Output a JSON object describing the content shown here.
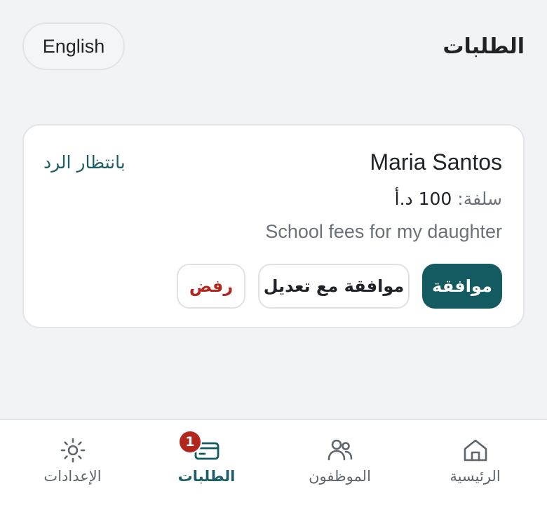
{
  "header": {
    "title": "الطلبات",
    "language_button": "English"
  },
  "request": {
    "employee_name": "Maria Santos",
    "status": "بانتظار الرد",
    "type_label": "سلفة:",
    "amount": "100 د.أ",
    "reason": "School fees for my daughter",
    "actions": {
      "approve": "موافقة",
      "approve_with_edit": "موافقة مع تعديل",
      "reject": "رفض"
    }
  },
  "nav": {
    "home": {
      "label": "الرئيسية",
      "icon": "home-icon"
    },
    "employees": {
      "label": "الموظفون",
      "icon": "people-icon"
    },
    "requests": {
      "label": "الطلبات",
      "icon": "card-icon",
      "badge": "1",
      "active": true
    },
    "settings": {
      "label": "الإعدادات",
      "icon": "sun-icon"
    }
  },
  "colors": {
    "accent": "#135b61",
    "danger": "#b3261e",
    "background": "#f2f3f5"
  }
}
